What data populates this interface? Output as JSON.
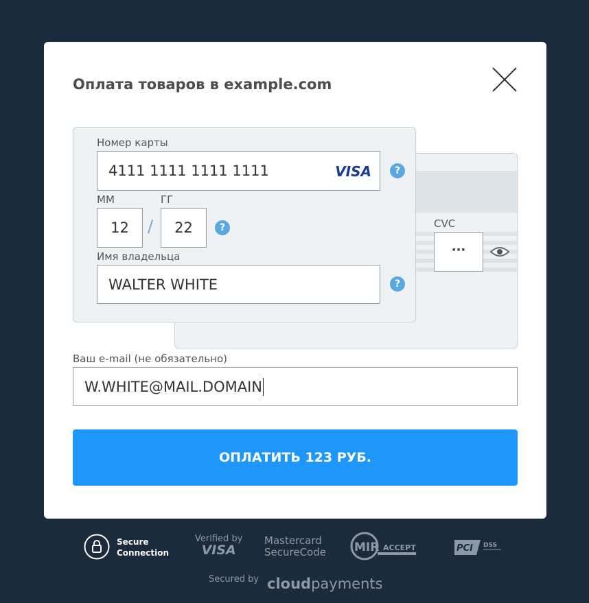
{
  "title": "Оплата товаров в example.com",
  "card": {
    "number_label": "Номер карты",
    "number_value": "4111 1111 1111 1111",
    "brand": "VISA",
    "month_label": "ММ",
    "year_label": "ГГ",
    "month_value": "12",
    "year_value": "22",
    "separator": "/",
    "holder_label": "Имя владельца",
    "holder_value": "WALTER WHITE",
    "cvc_label": "CVC",
    "cvc_value": "···",
    "help_glyph": "?"
  },
  "email": {
    "label": "Ваш e-mail (не обязательно)",
    "value": "W.WHITE@MAIL.DOMAIN"
  },
  "pay_button": "ОПЛАТИТЬ 123 РУБ.",
  "footer": {
    "secure_line1": "Secure",
    "secure_line2": "Connection",
    "verified_line1": "Verified by",
    "verified_line2": "VISA",
    "mc_line1": "Mastercard",
    "mc_line2": "SecureCode",
    "mir_text1": "MIR",
    "mir_text2": "ACCEPT",
    "pci_text1": "PCI",
    "pci_text2": "DSS",
    "secured_by": "Secured by",
    "brand_part1": "cloud",
    "brand_part2": "payments"
  },
  "colors": {
    "background": "#1b2b3b",
    "accent": "#1e96fa",
    "help": "#5ba8e0",
    "visa": "#1a3a8c"
  }
}
